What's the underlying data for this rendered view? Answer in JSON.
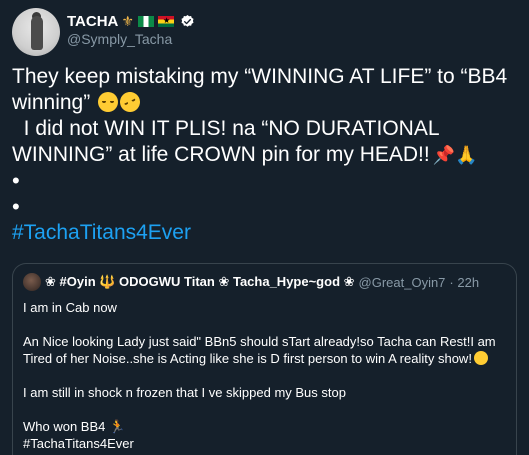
{
  "tweet": {
    "display_name": "TACHA",
    "handle": "@Symply_Tacha",
    "text_lines": [
      "They keep mistaking my “WINNING AT LIFE” to “BB4",
      "winning” ",
      "  I did not WIN IT PLIS! na “NO DURATIONAL",
      "WINNING” at life CROWN pin for my HEAD!!",
      "•",
      "•"
    ],
    "hashtag": "#TachaTitans4Ever"
  },
  "quoted_tweet": {
    "display_name": "❀ #Oyin 🔱 ODOGWU Titan ❀ Tacha_Hype~god ❀",
    "handle": "@Great_Oyin7",
    "time": "· 22h",
    "paragraphs": [
      "I am in Cab now",
      "An Nice looking Lady just said\" BBn5 should sTart already!so Tacha can Rest!I am Tired of her Noise..she is Acting like she is D first person to win A reality show!",
      "I am  still in shock n frozen that I ve skipped my Bus stop",
      "Who won BB4",
      "#TachaTitans4Ever"
    ]
  },
  "colors": {
    "background": "#15202b",
    "text": "#ffffff",
    "secondary_text": "#8899a6",
    "link": "#1da1f2",
    "border": "#38444d"
  },
  "icons": {
    "verified": "verified-badge-icon",
    "crown": "trident-emoji",
    "flag_ng": "nigeria-flag-emoji",
    "flag_gh": "ghana-flag-emoji"
  }
}
